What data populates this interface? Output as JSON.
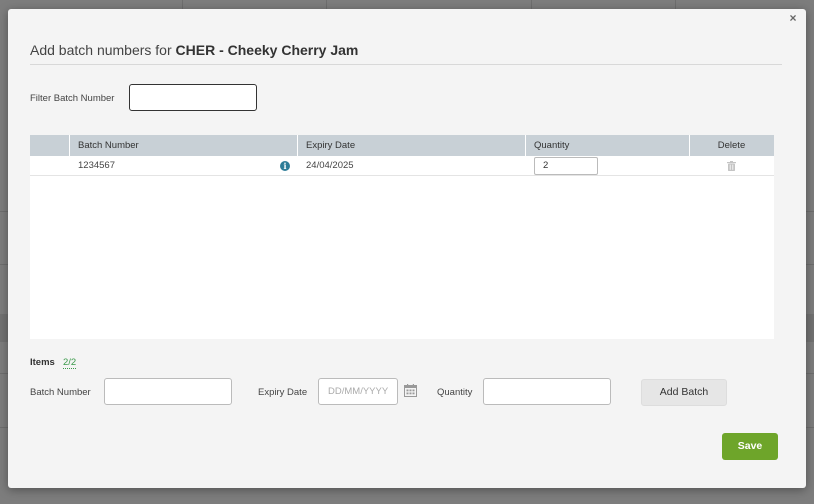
{
  "modal": {
    "title_prefix": "Add batch numbers for",
    "title_product": "CHER - Cheeky Cherry Jam",
    "close_label": "×"
  },
  "filter": {
    "label": "Filter Batch Number",
    "value": ""
  },
  "table": {
    "headers": [
      "Batch Number",
      "Expiry Date",
      "Quantity",
      "Delete"
    ],
    "rows": [
      {
        "batch_number": "1234567",
        "expiry_date": "24/04/2025",
        "quantity": "2"
      }
    ]
  },
  "items": {
    "label": "Items",
    "count": "2/2"
  },
  "add_form": {
    "batch_label": "Batch Number",
    "batch_value": "",
    "expiry_label": "Expiry Date",
    "expiry_placeholder": "DD/MM/YYYY",
    "quantity_label": "Quantity",
    "quantity_value": "",
    "add_button": "Add Batch"
  },
  "footer": {
    "save_button": "Save"
  },
  "colors": {
    "accent_green": "#6ea52a",
    "header_gray": "#c8d0d6",
    "info_blue": "#2e7d98"
  }
}
